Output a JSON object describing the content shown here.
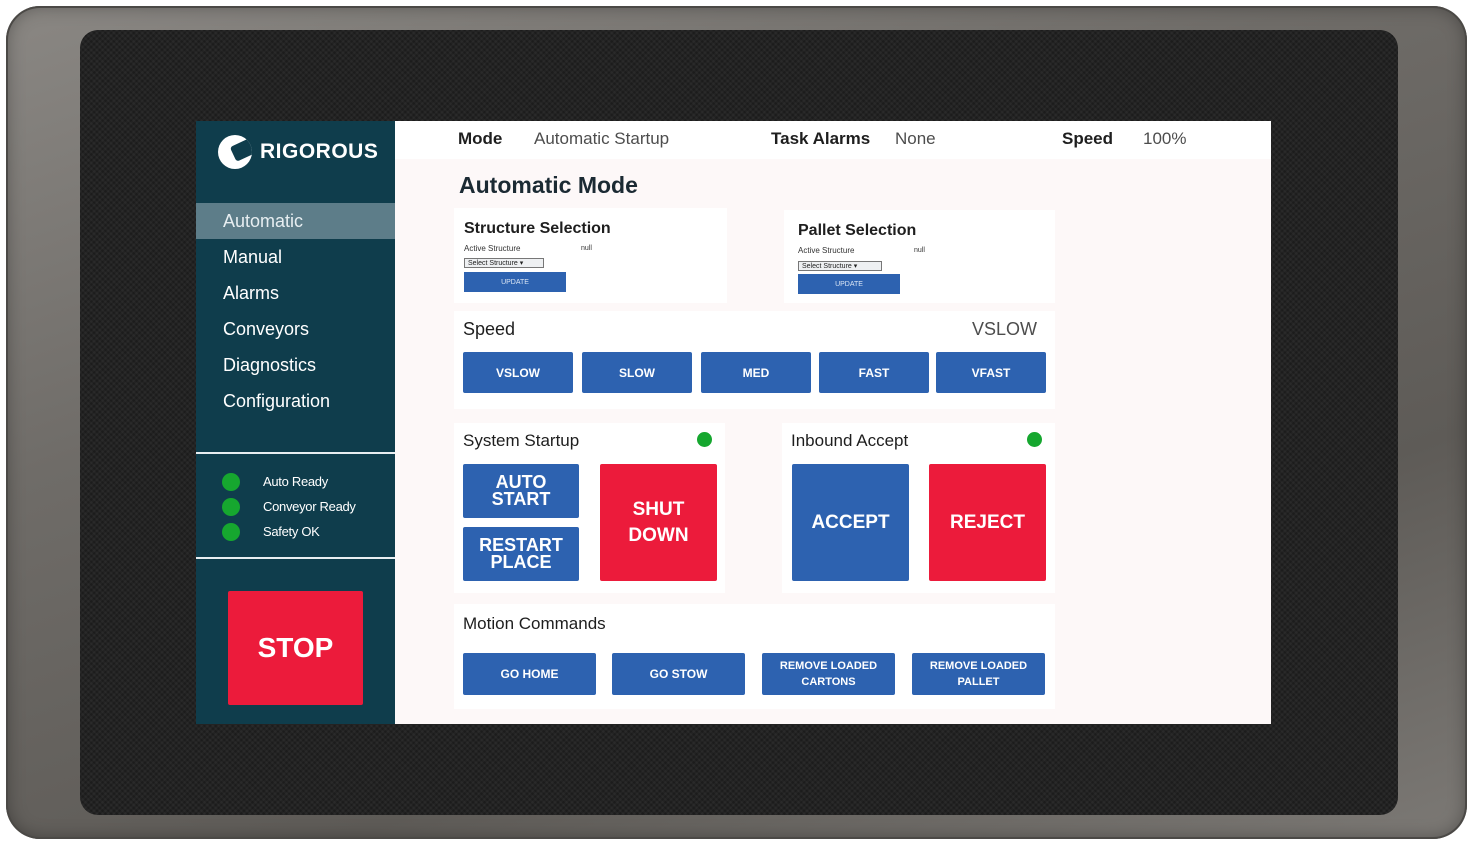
{
  "brand": {
    "name": "RIGOROUS"
  },
  "sidebar": {
    "items": [
      {
        "label": "Automatic",
        "active": true
      },
      {
        "label": "Manual"
      },
      {
        "label": "Alarms"
      },
      {
        "label": "Conveyors"
      },
      {
        "label": "Diagnostics"
      },
      {
        "label": "Configuration"
      }
    ],
    "status": [
      {
        "label": "Auto Ready",
        "state": "ok"
      },
      {
        "label": "Conveyor Ready",
        "state": "ok"
      },
      {
        "label": "Safety OK",
        "state": "ok"
      }
    ],
    "stop_label": "STOP"
  },
  "topbar": {
    "mode_key": "Mode",
    "mode_value": "Automatic Startup",
    "alarms_key": "Task Alarms",
    "alarms_value": "None",
    "speed_key": "Speed",
    "speed_value": "100%"
  },
  "page_title": "Automatic Mode",
  "structure_selection": {
    "title": "Structure Selection",
    "active_label": "Active Structure",
    "active_value": "null",
    "select_placeholder": "Select Structure",
    "update_label": "UPDATE"
  },
  "pallet_selection": {
    "title": "Pallet Selection",
    "active_label": "Active Structure",
    "active_value": "null",
    "select_placeholder": "Select Structure",
    "update_label": "UPDATE"
  },
  "speed_panel": {
    "title": "Speed",
    "current": "VSLOW",
    "buttons": [
      "VSLOW",
      "SLOW",
      "MED",
      "FAST",
      "VFAST"
    ]
  },
  "system_startup": {
    "title": "System Startup",
    "auto_start": "AUTO\nSTART",
    "restart_place": "RESTART\nPLACE",
    "shut_down": "SHUT\nDOWN"
  },
  "inbound_accept": {
    "title": "Inbound Accept",
    "accept": "ACCEPT",
    "reject": "REJECT"
  },
  "motion_commands": {
    "title": "Motion Commands",
    "buttons": [
      "GO HOME",
      "GO STOW",
      "REMOVE LOADED\nCARTONS",
      "REMOVE LOADED\nPALLET"
    ]
  },
  "colors": {
    "sidebar_bg": "#0f3d4c",
    "accent_blue": "#2d62b0",
    "danger_red": "#ec1b3b",
    "status_green": "#16a72f"
  },
  "icons": {
    "logo": "rigorous-logo-icon",
    "status": "status-dot-icon"
  }
}
